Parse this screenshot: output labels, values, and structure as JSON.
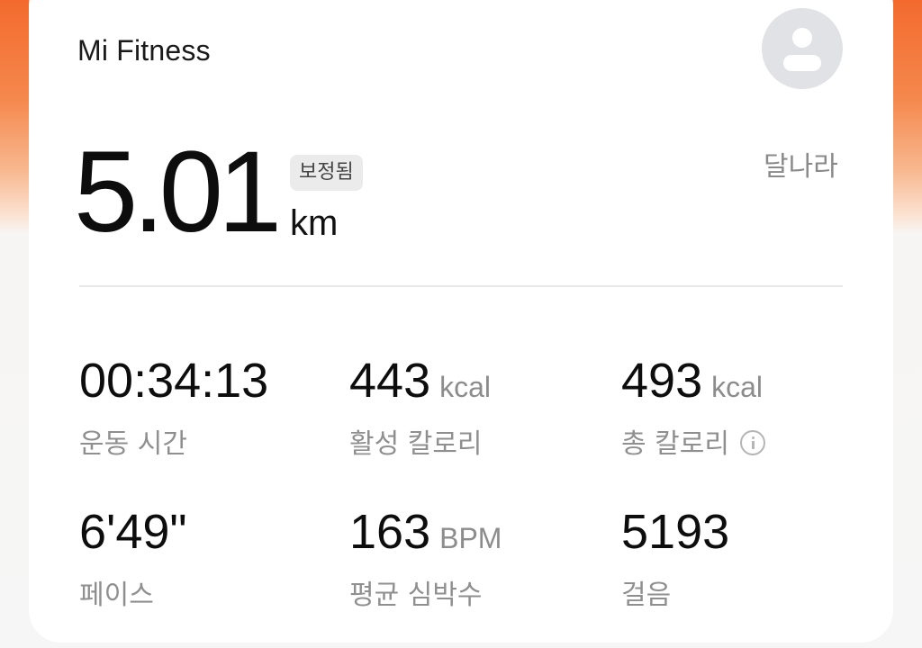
{
  "header": {
    "app_title": "Mi Fitness"
  },
  "summary": {
    "distance": "5.01",
    "distance_unit": "km",
    "badge": "보정됨",
    "activity_type": "달나라"
  },
  "stats": [
    {
      "value": "00:34:13",
      "unit": "",
      "label": "운동 시간"
    },
    {
      "value": "443",
      "unit": "kcal",
      "label": "활성 칼로리"
    },
    {
      "value": "493",
      "unit": "kcal",
      "label": "총 칼로리"
    },
    {
      "value": "6'49\"",
      "unit": "",
      "label": "페이스"
    },
    {
      "value": "163",
      "unit": "BPM",
      "label": "평균 심박수"
    },
    {
      "value": "5193",
      "unit": "",
      "label": "걸음"
    }
  ],
  "colors": {
    "accent": "#f36a2d",
    "card": "#ffffff",
    "muted_text": "#8f8f8f"
  },
  "icons": {
    "avatar": "user-avatar-icon",
    "info": "info-icon"
  }
}
